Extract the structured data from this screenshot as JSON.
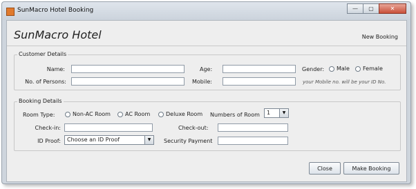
{
  "window": {
    "title": "SunMacro Hotel Booking",
    "controls": {
      "minimize": "—",
      "maximize": "▢",
      "close": "✕"
    }
  },
  "header": {
    "brand": "SunMacro Hotel",
    "mode": "New Booking"
  },
  "customer": {
    "legend": "Customer Details",
    "name_label": "Name:",
    "name_value": "",
    "age_label": "Age:",
    "age_value": "",
    "gender_label": "Gender:",
    "gender_options": [
      "Male",
      "Female"
    ],
    "persons_label": "No. of Persons:",
    "persons_value": "",
    "mobile_label": "Mobile:",
    "mobile_value": "",
    "mobile_hint": "your Mobile no. will be your ID No."
  },
  "booking": {
    "legend": "Booking Details",
    "room_type_label": "Room Type:",
    "room_options": [
      "Non-AC Room",
      "AC Room",
      "Deluxe Room"
    ],
    "num_rooms_label": "Numbers of Room",
    "num_rooms_value": "1",
    "checkin_label": "Check-in:",
    "checkin_value": "",
    "checkout_label": "Check-out:",
    "checkout_value": "",
    "id_proof_label": "ID Proof:",
    "id_proof_value": "Choose an ID Proof",
    "security_label": "Security Payment",
    "security_value": ""
  },
  "actions": {
    "close_label": "Close",
    "make_booking_label": "Make Booking"
  },
  "icons": {
    "dropdown_arrow": "▼"
  }
}
